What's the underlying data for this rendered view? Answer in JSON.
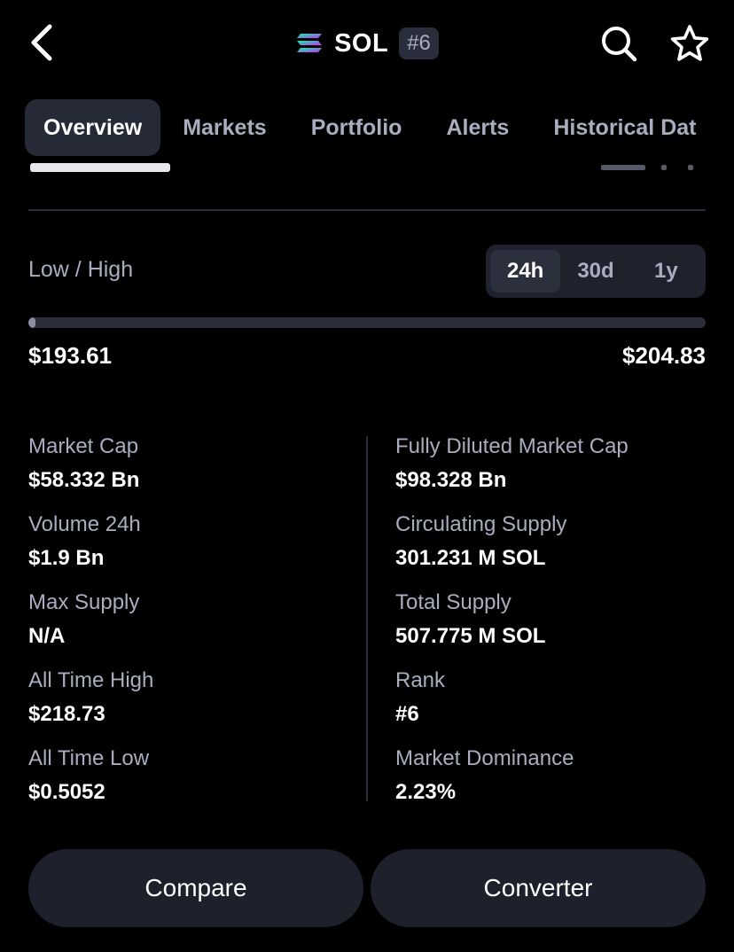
{
  "header": {
    "coin_symbol": "SOL",
    "rank_badge": "#6",
    "icons": [
      "back-arrow-icon",
      "solana-logo-icon",
      "search-icon",
      "star-icon"
    ]
  },
  "tabs": [
    {
      "label": "Overview",
      "active": true
    },
    {
      "label": "Markets",
      "active": false
    },
    {
      "label": "Portfolio",
      "active": false
    },
    {
      "label": "Alerts",
      "active": false
    },
    {
      "label": "Historical Dat",
      "active": false
    }
  ],
  "low_high": {
    "label": "Low / High",
    "periods": [
      {
        "label": "24h",
        "active": true
      },
      {
        "label": "30d",
        "active": false
      },
      {
        "label": "1y",
        "active": false
      }
    ],
    "low": "$193.61",
    "high": "$204.83",
    "position_fraction": 0.0
  },
  "stats_left": [
    {
      "label": "Market Cap",
      "value": "$58.332 Bn"
    },
    {
      "label": "Volume 24h",
      "value": "$1.9 Bn"
    },
    {
      "label": "Max Supply",
      "value": "N/A"
    },
    {
      "label": "All Time High",
      "value": "$218.73"
    },
    {
      "label": "All Time Low",
      "value": "$0.5052"
    }
  ],
  "stats_right": [
    {
      "label": "Fully Diluted Market Cap",
      "value": "$98.328 Bn"
    },
    {
      "label": "Circulating Supply",
      "value": "301.231 M SOL"
    },
    {
      "label": "Total Supply",
      "value": "507.775 M SOL"
    },
    {
      "label": "Rank",
      "value": "#6"
    },
    {
      "label": "Market Dominance",
      "value": "2.23%"
    }
  ],
  "actions": {
    "compare_label": "Compare",
    "converter_label": "Converter"
  },
  "colors": {
    "background": "#000000",
    "surface": "#1e212c",
    "muted_text": "#a9adbf",
    "divider": "#2a2d38"
  }
}
